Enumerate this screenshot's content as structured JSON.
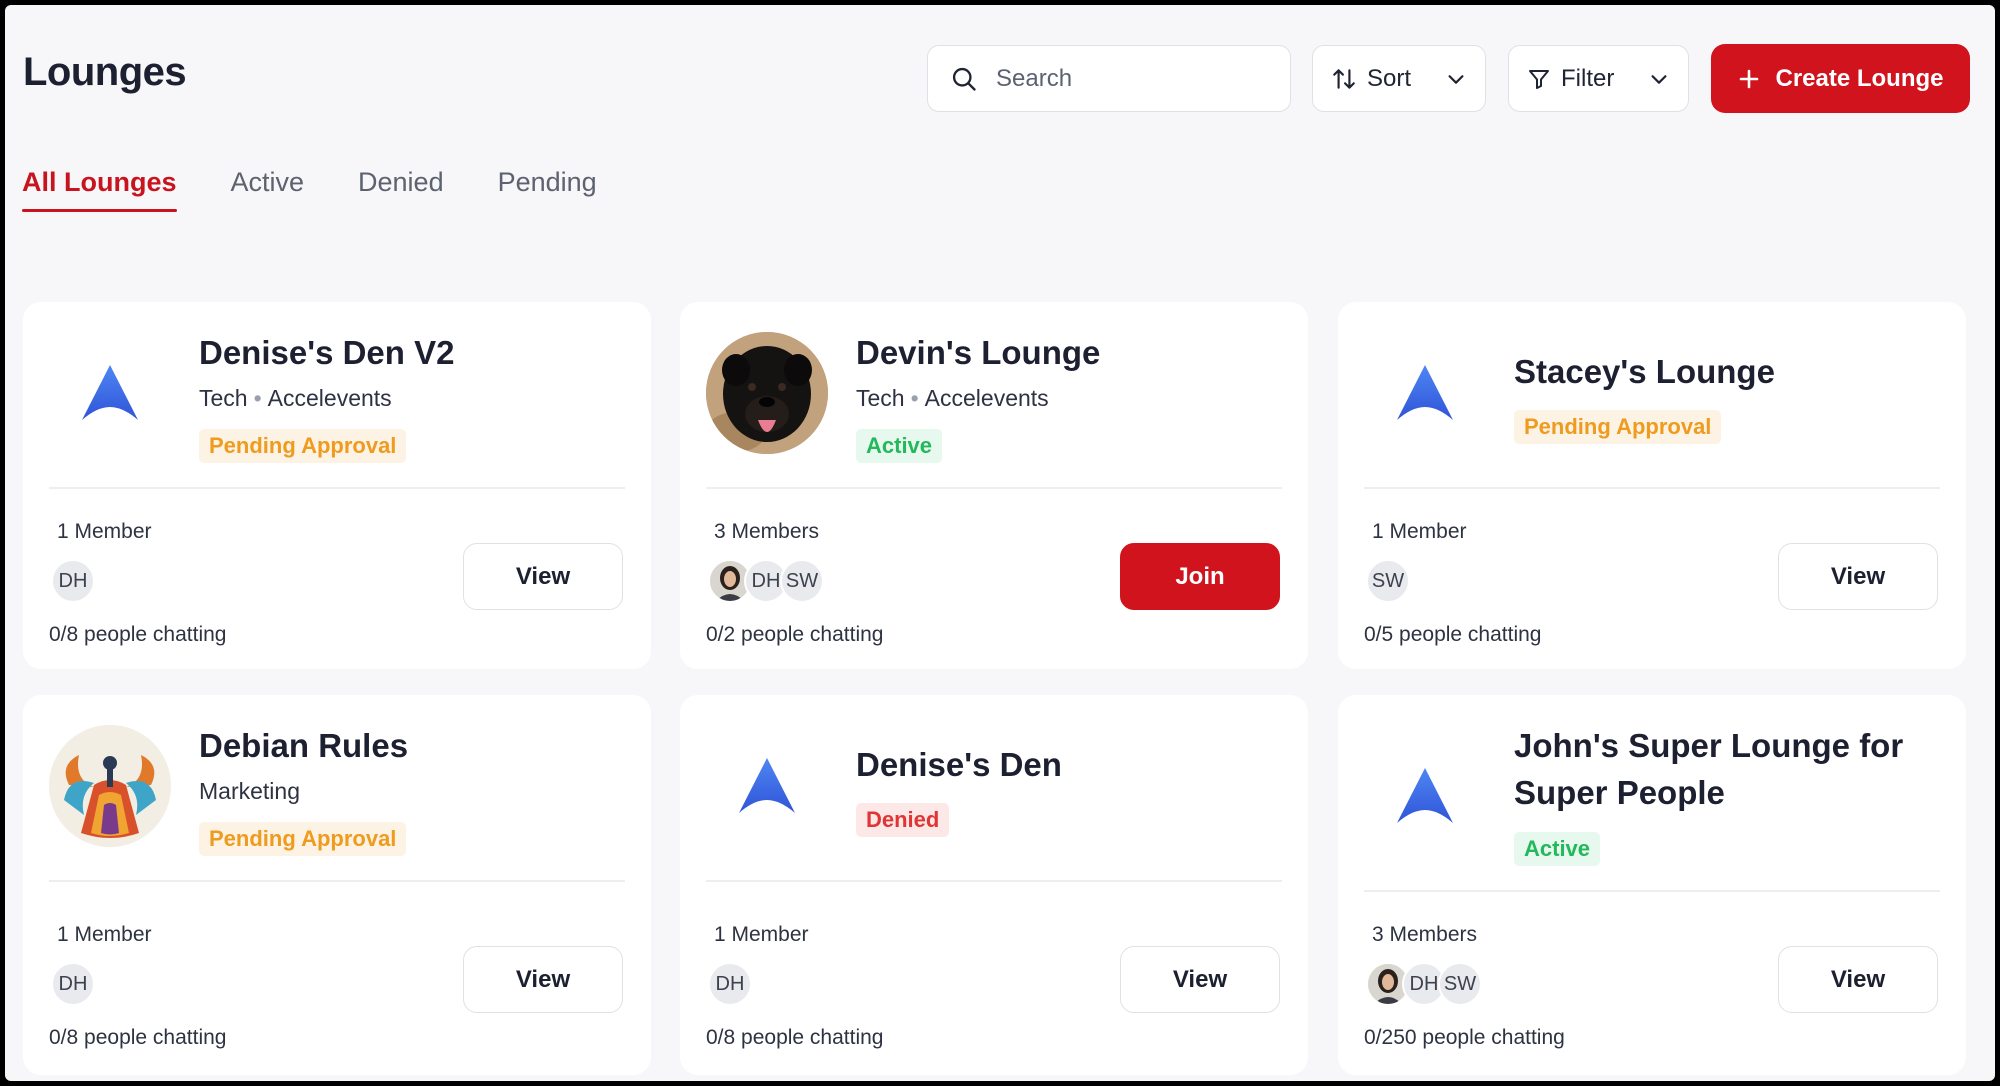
{
  "header": {
    "title": "Lounges",
    "search_placeholder": "Search",
    "sort_label": "Sort",
    "filter_label": "Filter",
    "create_label": "Create Lounge"
  },
  "tabs": [
    {
      "label": "All Lounges",
      "active": true
    },
    {
      "label": "Active",
      "active": false
    },
    {
      "label": "Denied",
      "active": false
    },
    {
      "label": "Pending",
      "active": false
    }
  ],
  "colors": {
    "brand_red": "#d0131d",
    "pending": "#ee9b1e",
    "active": "#23b85b",
    "denied": "#e13535",
    "logo_blue": "#3f6fe8"
  },
  "lounges": [
    {
      "title": "Denise's Den V2",
      "category": "Tech",
      "organizer": "Accelevents",
      "status": "Pending Approval",
      "logo": "accelevents-logo-icon",
      "members_label": "1 Member",
      "avatars": [
        "DH"
      ],
      "chatting": "0/8 people chatting",
      "action_label": "View"
    },
    {
      "title": "Devin's Lounge",
      "category": "Tech",
      "organizer": "Accelevents",
      "status": "Active",
      "logo": "dog-photo",
      "members_label": "3 Members",
      "avatars": [
        "photo",
        "DH",
        "SW"
      ],
      "chatting": "0/2 people chatting",
      "action_label": "Join"
    },
    {
      "title": "Stacey's Lounge",
      "status": "Pending Approval",
      "logo": "accelevents-logo-icon",
      "members_label": "1 Member",
      "avatars": [
        "SW"
      ],
      "chatting": "0/5 people chatting",
      "action_label": "View"
    },
    {
      "title": "Debian Rules",
      "category": "Marketing",
      "status": "Pending Approval",
      "logo": "dancer-art-photo",
      "members_label": "1 Member",
      "avatars": [
        "DH"
      ],
      "chatting": "0/8 people chatting",
      "action_label": "View"
    },
    {
      "title": "Denise's Den",
      "status": "Denied",
      "logo": "accelevents-logo-icon",
      "members_label": "1 Member",
      "avatars": [
        "DH"
      ],
      "chatting": "0/8 people chatting",
      "action_label": "View"
    },
    {
      "title": "John's Super Lounge for Super People",
      "status": "Active",
      "logo": "accelevents-logo-icon",
      "members_label": "3 Members",
      "avatars": [
        "photo",
        "DH",
        "SW"
      ],
      "chatting": "0/250 people chatting",
      "action_label": "View"
    }
  ]
}
